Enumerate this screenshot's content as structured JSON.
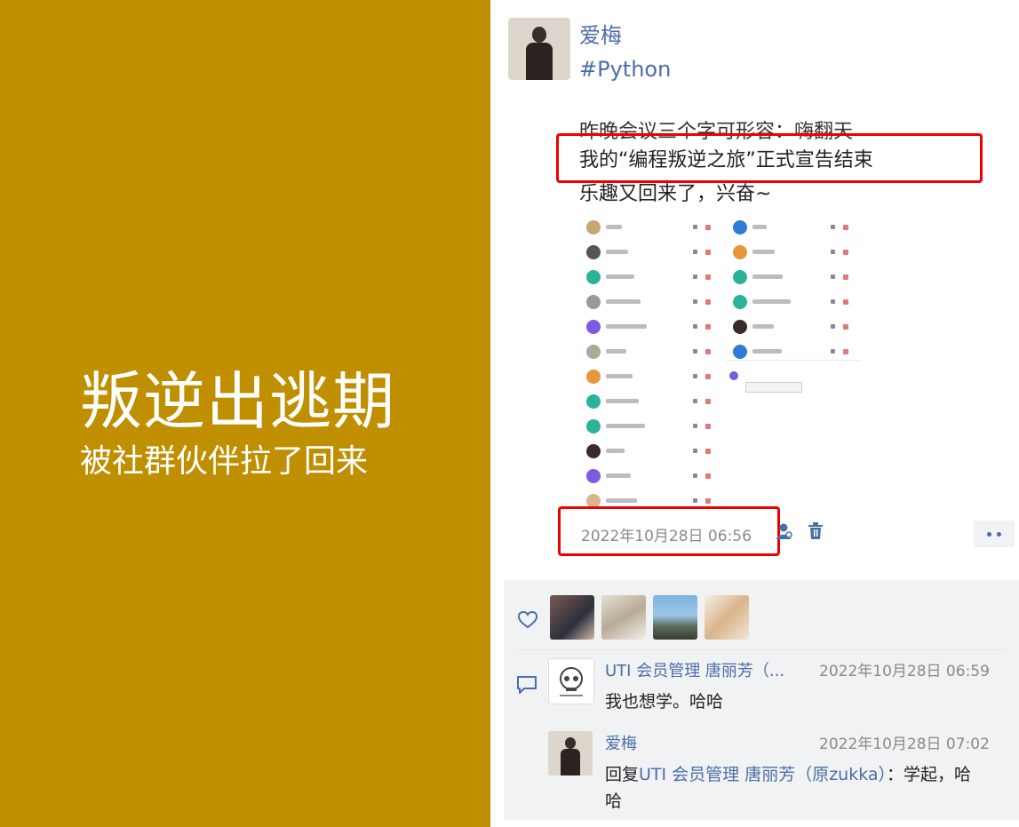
{
  "left_panel": {
    "title": "叛逆出逃期",
    "subtitle": "被社群伙伴拉了回来",
    "bg_color": "#bf8f00"
  },
  "post": {
    "author": "爱梅",
    "tag": "#Python",
    "lines": [
      "昨晚会议三个字可形容：嗨翻天",
      "我的“编程叛逆之旅”正式宣告结束",
      "乐趣又回来了，兴奋~"
    ],
    "timestamp": "2022年10月28日 06:56",
    "highlight_color": "#ee0000",
    "icons": [
      "user-icon",
      "trash-icon",
      "more-icon"
    ]
  },
  "likes": {
    "icon": "heart-icon",
    "count_shown": 4
  },
  "comments": [
    {
      "author": "UTI 会员管理 唐丽芳（...",
      "time": "2022年10月28日 06:59",
      "text": "我也想学。哈哈"
    },
    {
      "author": "爱梅",
      "time": "2022年10月28日 07:02",
      "reply_prefix": "回复",
      "mention": "UTI 会员管理 唐丽芳（原zukka）",
      "text": "：学起，哈哈"
    }
  ]
}
